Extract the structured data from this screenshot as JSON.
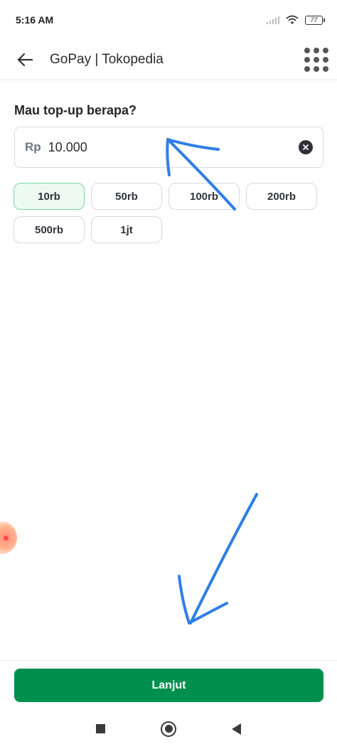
{
  "status_bar": {
    "time": "5:16 AM",
    "battery": "77",
    "icons": [
      "signal-icon",
      "wifi-icon",
      "battery-icon"
    ]
  },
  "header": {
    "title": "GoPay | Tokopedia",
    "back_icon": "arrow-left-icon",
    "menu_icon": "grid-menu-icon"
  },
  "topup": {
    "question": "Mau top-up berapa?",
    "currency": "Rp",
    "amount_value": "10.000",
    "clear_icon": "clear-icon",
    "chips": [
      {
        "label": "10rb",
        "selected": true
      },
      {
        "label": "50rb",
        "selected": false
      },
      {
        "label": "100rb",
        "selected": false
      },
      {
        "label": "200rb",
        "selected": false
      },
      {
        "label": "500rb",
        "selected": false
      },
      {
        "label": "1jt",
        "selected": false
      }
    ]
  },
  "footer": {
    "button_label": "Lanjut"
  },
  "colors": {
    "primary": "#00904e",
    "chip_selected_bg": "#ecfaf2",
    "chip_selected_border": "#7fd6a6",
    "annotation": "#2f7ee6"
  },
  "navigation": {
    "icons": [
      "recents-icon",
      "home-icon",
      "back-icon"
    ]
  }
}
